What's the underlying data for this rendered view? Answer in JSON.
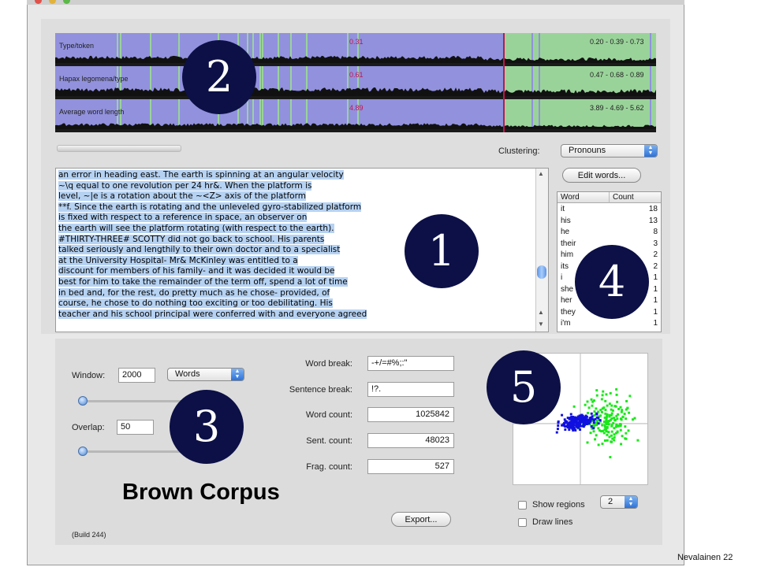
{
  "tracks": [
    {
      "label": "Type/token",
      "mid": "0.31",
      "range": "0.20 - 0.39 - 0.73"
    },
    {
      "label": "Hapax legomena/type",
      "mid": "0.61",
      "range": "0.47 - 0.68 - 0.89"
    },
    {
      "label": "Average word length",
      "mid": "4.89",
      "range": "3.89 - 4.69 - 5.62"
    }
  ],
  "clustering": {
    "label": "Clustering:",
    "value": "Pronouns"
  },
  "edit_words_label": "Edit words...",
  "text_lines": [
    "an error in heading east. The earth is spinning at an angular velocity",
    "~\\q equal to one revolution per 24 hr&. When the platform is",
    "level, ~|e is a rotation about the ~<Z> axis of the platform",
    "**f. Since the earth is rotating and the unleveled gyro-stabilized platform",
    "is fixed with respect to a reference in space, an observer on",
    "the earth will see the platform rotating (with respect to the earth).",
    "#THIRTY-THREE# SCOTTY did not go back to school. His parents",
    "talked seriously and lengthily to their own doctor and to a specialist",
    "at the University Hospital- Mr& McKinley was entitled to a",
    "discount for members of his family- and it was decided it would be",
    "best for him to take the remainder of the term off, spend a lot of time",
    "in bed and, for the rest, do pretty much as he chose- provided, of",
    "course, he chose to do nothing too exciting or too debilitating. His",
    "teacher and his school principal were conferred with and everyone agreed"
  ],
  "word_table": {
    "headers": [
      "Word",
      "Count"
    ],
    "rows": [
      {
        "word": "it",
        "count": "18"
      },
      {
        "word": "his",
        "count": "13"
      },
      {
        "word": "he",
        "count": "8"
      },
      {
        "word": "their",
        "count": "3"
      },
      {
        "word": "him",
        "count": "2"
      },
      {
        "word": "its",
        "count": "2"
      },
      {
        "word": "i",
        "count": "1"
      },
      {
        "word": "she",
        "count": "1"
      },
      {
        "word": "her",
        "count": "1"
      },
      {
        "word": "they",
        "count": "1"
      },
      {
        "word": "i'm",
        "count": "1"
      }
    ]
  },
  "window": {
    "label": "Window:",
    "value": "2000",
    "unit": "Words",
    "slider_fraction": 0.0
  },
  "overlap": {
    "label": "Overlap:",
    "value": "50",
    "slider_fraction": 0.0
  },
  "fields": [
    {
      "label": "Word break:",
      "value": "-+/=#%;:\"",
      "align": "left"
    },
    {
      "label": "Sentence break:",
      "value": "!?.",
      "align": "left"
    },
    {
      "label": "Word count:",
      "value": "1025842",
      "align": "right"
    },
    {
      "label": "Sent. count:",
      "value": "48023",
      "align": "right"
    },
    {
      "label": "Frag. count:",
      "value": "527",
      "align": "right"
    }
  ],
  "corpus_title": "Brown Corpus",
  "export_label": "Export...",
  "build_label": "(Build 244)",
  "show_regions": {
    "label": "Show regions",
    "checked": false
  },
  "draw_lines": {
    "label": "Draw lines",
    "checked": false
  },
  "regions_count": "2",
  "callouts": [
    "1",
    "2",
    "3",
    "4",
    "5"
  ],
  "footer": "Nevalainen 22",
  "colors": {
    "track_purple": "#9191dd",
    "track_green": "#9ad39a",
    "marker_red": "#c0154f",
    "selection": "#b6d2f2",
    "scatter_blue": "#1010e0",
    "scatter_green": "#18e818",
    "callout_bg": "#0c1046"
  }
}
